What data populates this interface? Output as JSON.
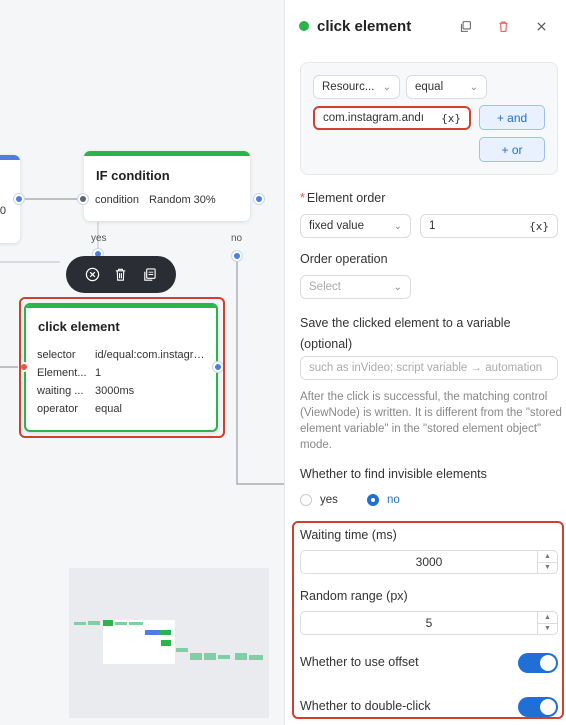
{
  "canvas": {
    "left_node_value": "0",
    "if_node": {
      "title": "IF condition",
      "condition_label": "condition",
      "condition_value": "Random 30%"
    },
    "branch_yes": "yes",
    "branch_no": "no",
    "click_node": {
      "title": "click element",
      "rows": [
        {
          "key": "selector",
          "value": "id/equal:com.instagra..."
        },
        {
          "key": "Element...",
          "value": "1"
        },
        {
          "key": "waiting ...",
          "value": "3000ms"
        },
        {
          "key": "operator",
          "value": "equal"
        }
      ]
    },
    "toolbar_icons": [
      "cancel-circle-icon",
      "trash-icon",
      "copy-icon"
    ]
  },
  "panel": {
    "title": "click element",
    "accent": "#2bb44a",
    "condition": {
      "field_select": "Resourc...",
      "operator_select": "equal",
      "value_input": "com.instagram.andı",
      "var_button": "{x}",
      "and_button": "+ and",
      "or_button": "+ or"
    },
    "element_order": {
      "label": "Element order",
      "mode_select": "fixed value",
      "value": "1",
      "var_button": "{x}"
    },
    "order_operation": {
      "label": "Order operation",
      "placeholder": "Select"
    },
    "save_variable": {
      "label": "Save the clicked element to a variable (optional)",
      "placeholder": "such as inVideo; script variable → automation",
      "description": "After the click is successful, the matching control (ViewNode) is written. It is different from the \"stored element variable\" in the \"stored element object\" mode."
    },
    "invisible": {
      "label": "Whether to find invisible elements",
      "yes": "yes",
      "no": "no",
      "selected": "no"
    },
    "waiting_time": {
      "label": "Waiting time (ms)",
      "value": "3000"
    },
    "random_range": {
      "label": "Random range (px)",
      "value": "5"
    },
    "use_offset": {
      "label": "Whether to use offset",
      "on": true
    },
    "double_click": {
      "label": "Whether to double-click",
      "on": true
    },
    "brand_blue": "#1f6fd6",
    "highlight_red": "#d0402f"
  }
}
